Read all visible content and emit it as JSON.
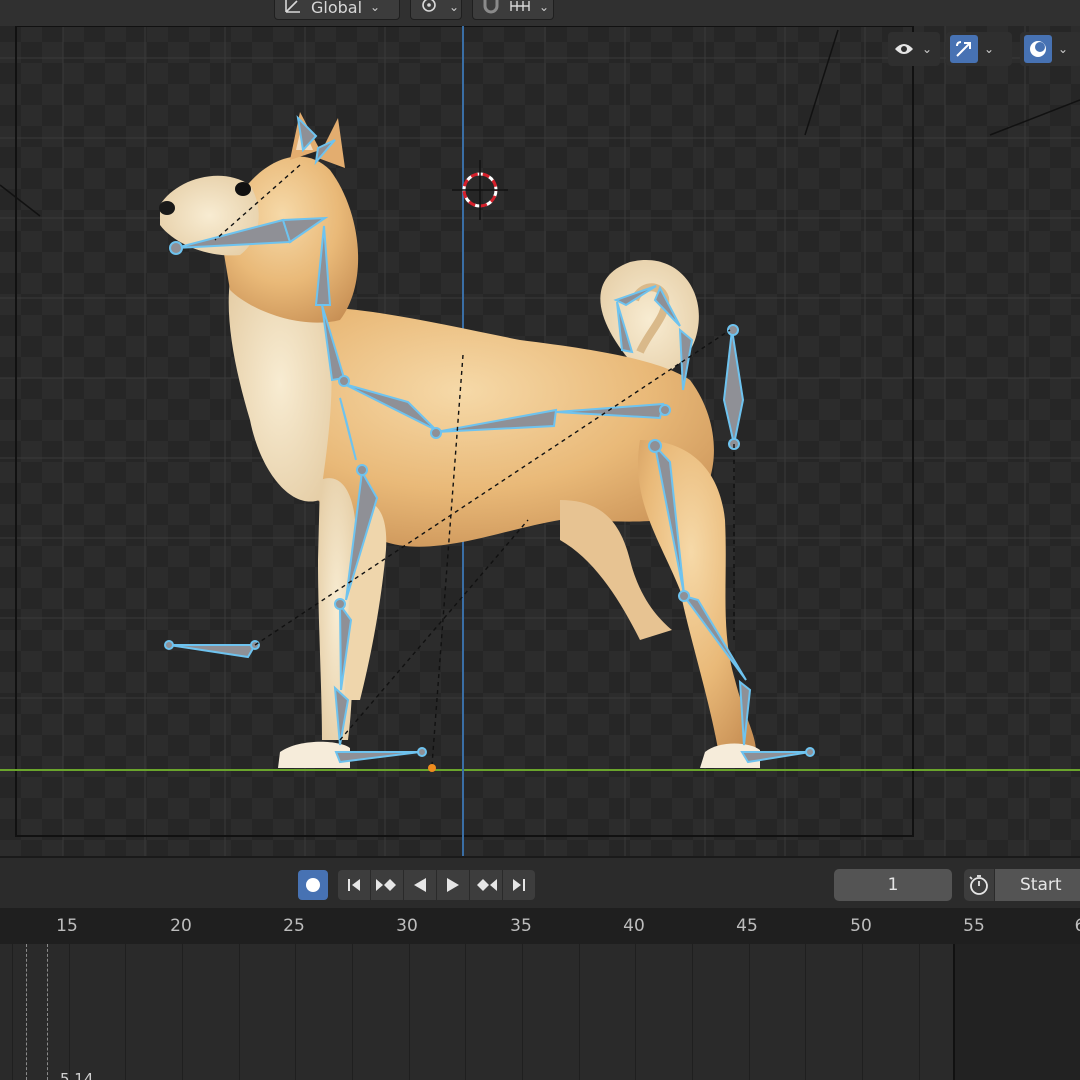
{
  "app": "Blender",
  "viewport_header": {
    "orientation_label": "Global",
    "orientation_icon": "transform-orientation-icon",
    "pivot_icon": "pivot-point-icon",
    "snap_icon": "snap-magnet-icon",
    "snap_increment_icon": "snap-increment-icon"
  },
  "viewport_overlays": {
    "visibility_icon": "eye-visibility-icon",
    "gizmo_icon": "gizmo-icon",
    "overlays_icon": "overlays-icon",
    "active_color": "#4772b3"
  },
  "scene": {
    "subject": "shiba inu dog 3d model with armature bones",
    "bone_color": "#6ec3ef",
    "bone_fill": "#8f9096",
    "ground_axis_color": "#6aa52c",
    "vertical_axis_color": "#3a6ea5"
  },
  "playback": {
    "record_icon": "record-autokey-icon",
    "jump_start_icon": "jump-to-start-icon",
    "prev_keyframe_icon": "previous-keyframe-icon",
    "play_reverse_icon": "play-reverse-icon",
    "play_icon": "play-icon",
    "next_keyframe_icon": "next-keyframe-icon",
    "jump_end_icon": "jump-to-end-icon",
    "current_frame": "1",
    "stopwatch_icon": "stopwatch-icon",
    "start_label": "Start"
  },
  "timeline": {
    "ticks": [
      "15",
      "20",
      "25",
      "30",
      "35",
      "40",
      "45",
      "50",
      "55",
      "6"
    ]
  },
  "status": {
    "text": "5.14"
  }
}
